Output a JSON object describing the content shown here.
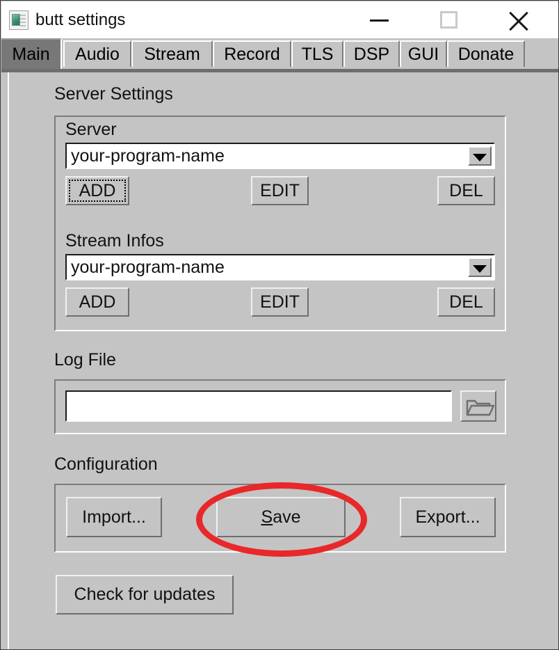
{
  "window": {
    "title": "butt settings",
    "icon": "app-window-icon",
    "background_color": "#c4c4c4",
    "controls": {
      "minimize": "minimize-icon",
      "maximize": "maximize-icon",
      "close": "close-icon"
    }
  },
  "tabs": [
    {
      "label": "Main",
      "selected": true
    },
    {
      "label": "Audio",
      "selected": false
    },
    {
      "label": "Stream",
      "selected": false
    },
    {
      "label": "Record",
      "selected": false
    },
    {
      "label": "TLS",
      "selected": false
    },
    {
      "label": "DSP",
      "selected": false
    },
    {
      "label": "GUI",
      "selected": false
    },
    {
      "label": "Donate",
      "selected": false
    }
  ],
  "server_settings": {
    "group_label": "Server Settings",
    "server": {
      "label": "Server",
      "value": "your-program-name",
      "dropdown_icon": "chevron-down-icon",
      "buttons": {
        "add": "ADD",
        "edit": "EDIT",
        "del": "DEL"
      },
      "add_focused": true
    },
    "stream_infos": {
      "label": "Stream Infos",
      "value": "your-program-name",
      "dropdown_icon": "chevron-down-icon",
      "buttons": {
        "add": "ADD",
        "edit": "EDIT",
        "del": "DEL"
      },
      "add_focused": false
    }
  },
  "log_file": {
    "group_label": "Log File",
    "path_value": "",
    "browse_icon": "folder-open-icon"
  },
  "configuration": {
    "group_label": "Configuration",
    "import_label": "Import...",
    "save_label": "Save",
    "save_mnemonic": "S",
    "save_label_rest": "ave",
    "export_label": "Export..."
  },
  "updates": {
    "check_label": "Check for updates"
  },
  "annotation": {
    "shape": "ellipse",
    "color": "#e8282a",
    "targets": "save-button"
  }
}
